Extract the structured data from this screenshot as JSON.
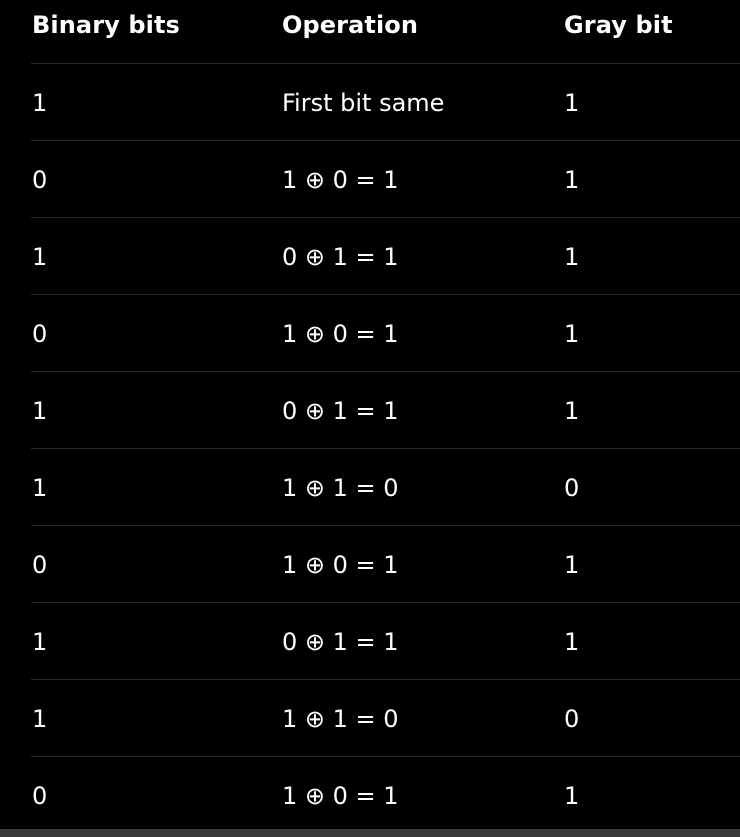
{
  "table": {
    "headers": [
      "Binary bits",
      "Operation",
      "Gray bit"
    ],
    "rows": [
      [
        "1",
        "First bit same",
        "1"
      ],
      [
        "0",
        "1 ⊕ 0 = 1",
        "1"
      ],
      [
        "1",
        "0 ⊕ 1 = 1",
        "1"
      ],
      [
        "0",
        "1 ⊕ 0 = 1",
        "1"
      ],
      [
        "1",
        "0 ⊕ 1 = 1",
        "1"
      ],
      [
        "1",
        "1 ⊕ 1 = 0",
        "0"
      ],
      [
        "0",
        "1 ⊕ 0 = 1",
        "1"
      ],
      [
        "1",
        "0 ⊕ 1 = 1",
        "1"
      ],
      [
        "1",
        "1 ⊕ 1 = 0",
        "0"
      ],
      [
        "0",
        "1 ⊕ 0 = 1",
        "1"
      ]
    ]
  },
  "colors": {
    "background": "#000000",
    "text": "#ffffff",
    "divider": "#2a2a2a",
    "bottom_bar": "#3a3a3c"
  }
}
